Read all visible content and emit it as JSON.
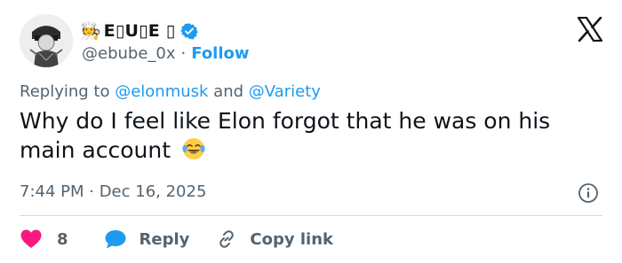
{
  "author": {
    "badge_emoji": "🧑‍🍳",
    "display_name": "E▯U▯E ▯",
    "handle": "@ebube_0x",
    "separator": "·",
    "follow_label": "Follow"
  },
  "reply_context": {
    "prefix": "Replying to ",
    "mention_1": "@elonmusk",
    "connector": " and ",
    "mention_2": "@Variety"
  },
  "tweet": {
    "text": "Why do I feel like Elon forgot that he was on his main account",
    "timestamp": "7:44 PM · Dec 16, 2025"
  },
  "actions": {
    "like_count": "8",
    "reply_label": "Reply",
    "copy_label": "Copy link"
  },
  "colors": {
    "accent": "#1d9bf0",
    "like": "#f91880",
    "secondary_text": "#536471",
    "primary_text": "#0f1419",
    "divider": "#cfd9de"
  },
  "icons": {
    "verified": "verified-badge-icon",
    "platform": "x-logo-icon",
    "laugh": "face-with-tears-of-joy-icon",
    "info": "info-icon",
    "like": "heart-icon",
    "reply": "speech-bubble-icon",
    "copy": "link-icon"
  }
}
